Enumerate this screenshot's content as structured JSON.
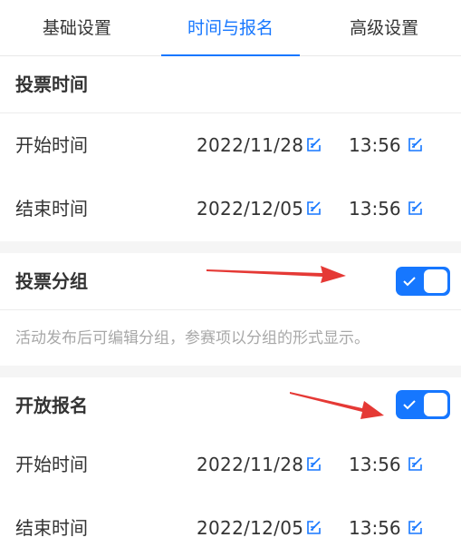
{
  "tabs": [
    {
      "label": "基础设置",
      "active": false
    },
    {
      "label": "时间与报名",
      "active": true
    },
    {
      "label": "高级设置",
      "active": false
    }
  ],
  "vote_time": {
    "title": "投票时间",
    "start": {
      "label": "开始时间",
      "date": "2022/11/28",
      "time": "13:56"
    },
    "end": {
      "label": "结束时间",
      "date": "2022/12/05",
      "time": "13:56"
    }
  },
  "vote_group": {
    "title": "投票分组",
    "enabled": true,
    "hint": "活动发布后可编辑分组，参赛项以分组的形式显示。"
  },
  "registration": {
    "title": "开放报名",
    "enabled": true,
    "start": {
      "label": "开始时间",
      "date": "2022/11/28",
      "time": "13:56"
    },
    "end": {
      "label": "结束时间",
      "date": "2022/12/05",
      "time": "13:56"
    }
  },
  "colors": {
    "accent": "#1677ff",
    "annotation_arrow": "#e53935",
    "background": "#f5f5f5"
  },
  "icons": {
    "edit": "edit-icon",
    "toggle_check": "check-icon"
  }
}
